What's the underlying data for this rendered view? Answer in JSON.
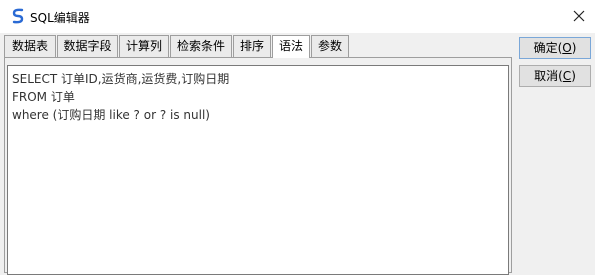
{
  "window": {
    "title": "SQL编辑器"
  },
  "tabs": [
    {
      "label": "数据表"
    },
    {
      "label": "数据字段"
    },
    {
      "label": "计算列"
    },
    {
      "label": "检索条件"
    },
    {
      "label": "排序"
    },
    {
      "label": "语法",
      "active": true
    },
    {
      "label": "参数"
    }
  ],
  "editor": {
    "lines": [
      "SELECT 订单ID,运货商,运货费,订购日期",
      "FROM 订单",
      "where (订购日期 like ? or ? is null)"
    ]
  },
  "buttons": {
    "ok": {
      "label": "确定(",
      "key": "O",
      "suffix": ")"
    },
    "cancel": {
      "label": "取消(",
      "key": "C",
      "suffix": ")"
    }
  },
  "colors": {
    "accent": "#2a6ad4",
    "border": "#9e9e9e"
  }
}
